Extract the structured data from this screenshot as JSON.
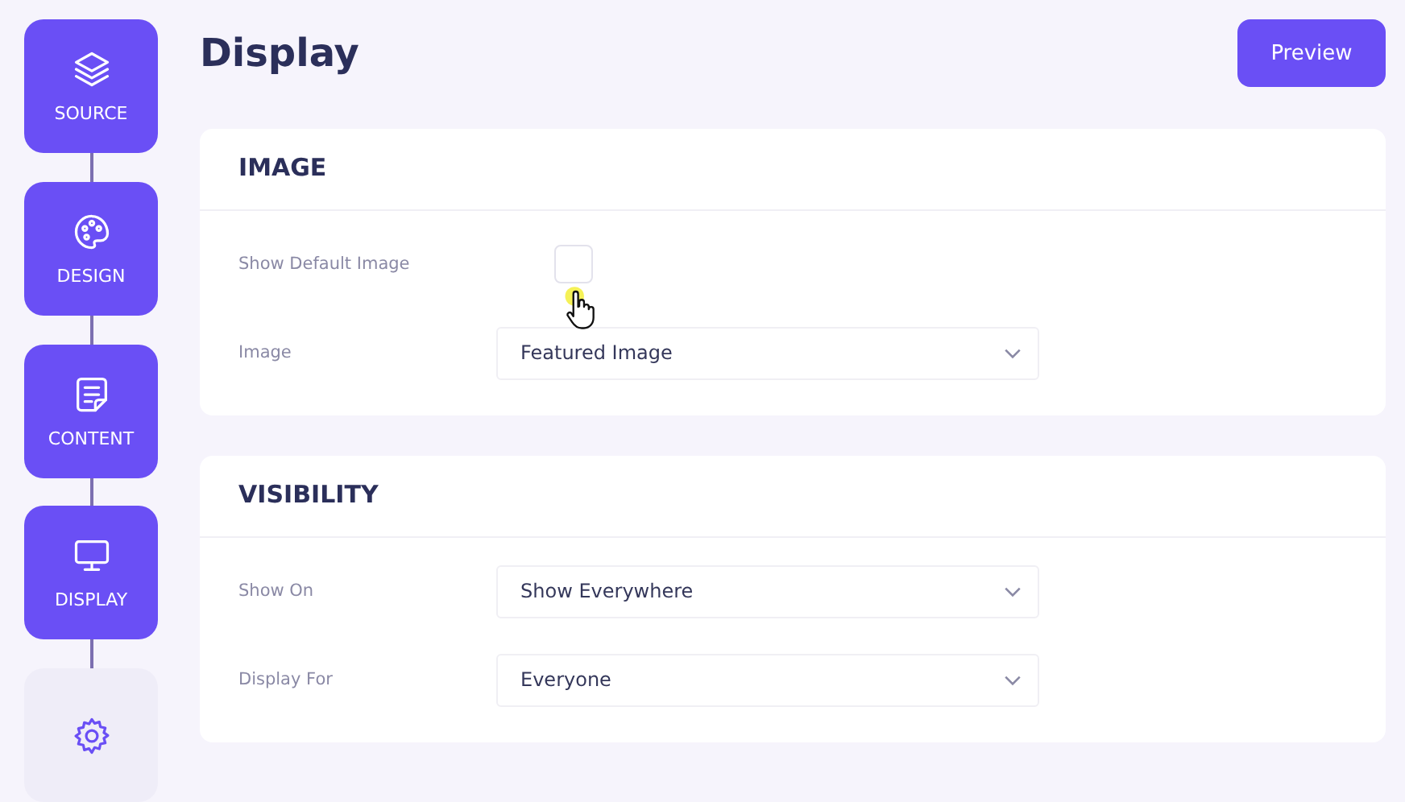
{
  "steps": [
    {
      "label": "SOURCE",
      "kind": "layers",
      "done": true
    },
    {
      "label": "DESIGN",
      "kind": "palette",
      "done": true
    },
    {
      "label": "CONTENT",
      "kind": "document",
      "done": true
    },
    {
      "label": "DISPLAY",
      "kind": "monitor",
      "done": true
    },
    {
      "kind": "settings",
      "done": false
    }
  ],
  "page_title": "Display",
  "preview_button": "Preview",
  "sections": [
    {
      "title": "IMAGE",
      "fields": [
        {
          "kind": "checkbox",
          "label": "Show Default Image",
          "checked": false
        },
        {
          "kind": "select",
          "label": "Image",
          "value": "Featured Image"
        }
      ]
    },
    {
      "title": "VISIBILITY",
      "fields": [
        {
          "kind": "select",
          "label": "Show On",
          "value": "Show Everywhere"
        },
        {
          "kind": "select",
          "label": "Display For",
          "value": "Everyone"
        }
      ]
    }
  ]
}
